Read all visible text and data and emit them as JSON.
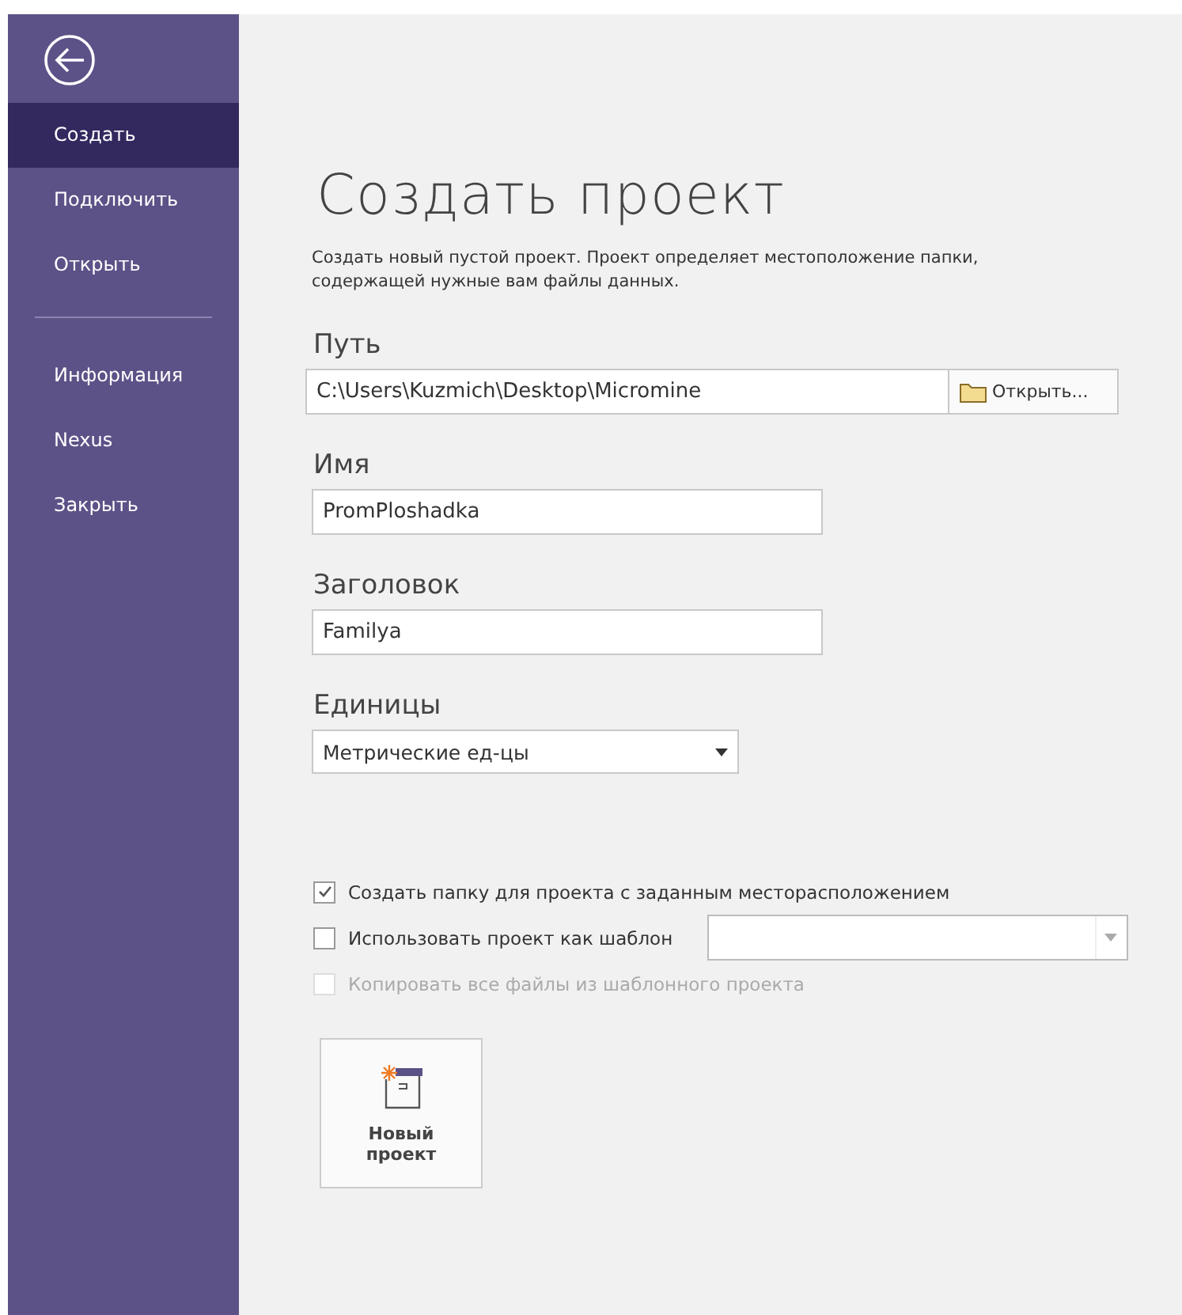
{
  "sidebar": {
    "groups": [
      [
        {
          "label": "Создать",
          "selected": true
        },
        {
          "label": "Подключить",
          "selected": false
        },
        {
          "label": "Открыть",
          "selected": false
        }
      ],
      [
        {
          "label": "Информация",
          "selected": false
        },
        {
          "label": "Nexus",
          "selected": false
        },
        {
          "label": "Закрыть",
          "selected": false
        }
      ]
    ]
  },
  "main": {
    "title": "Создать проект",
    "description": "Создать новый пустой проект. Проект определяет местоположение папки, содержащей нужные вам файлы данных.",
    "path": {
      "label": "Путь",
      "value": "C:\\Users\\Kuzmich\\Desktop\\Micromine",
      "button": "Открыть..."
    },
    "name": {
      "label": "Имя",
      "value": "PromPloshadka"
    },
    "heading": {
      "label": "Заголовок",
      "value": "Familya"
    },
    "units": {
      "label": "Единицы",
      "value": "Метрические ед-цы"
    },
    "options": [
      {
        "label": "Создать папку для проекта с заданным месторасположением",
        "checked": true,
        "disabled": false
      },
      {
        "label": "Использовать проект как шаблон",
        "checked": false,
        "disabled": false,
        "kind": "with-combo"
      },
      {
        "label": "Копировать все файлы из шаблонного проекта",
        "checked": false,
        "disabled": true
      }
    ],
    "create_button": "Новый проект"
  }
}
